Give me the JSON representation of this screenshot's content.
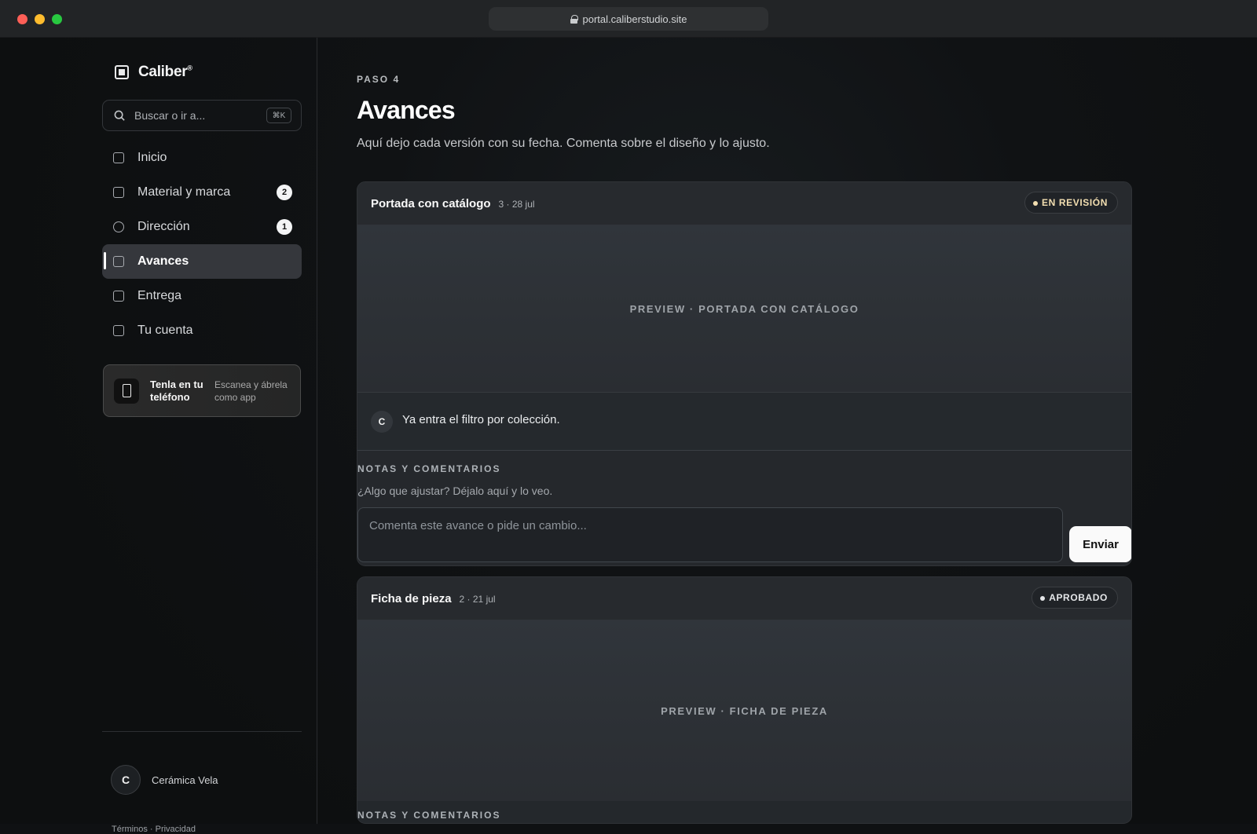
{
  "browser": {
    "url": "portal.caliberstudio.site"
  },
  "brand": {
    "name": "Caliber",
    "trademark": "®"
  },
  "search": {
    "placeholder": "Buscar o ir a...",
    "shortcut": "⌘K"
  },
  "navigation": [
    {
      "label": "Inicio",
      "icon": "home-icon"
    },
    {
      "label": "Material y marca",
      "icon": "image-icon",
      "badge": "2"
    },
    {
      "label": "Dirección",
      "icon": "target-icon",
      "badge": "1"
    },
    {
      "label": "Avances",
      "icon": "chart-icon",
      "active": true
    },
    {
      "label": "Entrega",
      "icon": "package-icon"
    },
    {
      "label": "Tu cuenta",
      "icon": "card-icon"
    }
  ],
  "phone_promo": {
    "title": "Tenla en tu teléfono",
    "subtitle": "Escanea y ábrela como app"
  },
  "user": {
    "initial": "C",
    "name": "Cerámica Vela"
  },
  "legal": "Términos · Privacidad",
  "page": {
    "step": "PASO 4",
    "title": "Avances",
    "subtitle": "Aquí dejo cada versión con su fecha. Comenta sobre el diseño y lo ajusto."
  },
  "cards": [
    {
      "title": "Portada con catálogo",
      "meta": "3 · 28 jul",
      "status": "EN REVISIÓN",
      "status_color": "#f3dfb1",
      "preview": "PREVIEW · PORTADA CON CATÁLOGO",
      "comment_initial": "C",
      "comment": "Ya entra el filtro por colección.",
      "notes_title": "NOTAS Y COMENTARIOS",
      "notes_help": "¿Algo que ajustar? Déjalo aquí y lo veo.",
      "input_placeholder": "Comenta este avance o pide un cambio...",
      "send_label": "Enviar"
    },
    {
      "title": "Ficha de pieza",
      "meta": "2 · 21 jul",
      "status": "APROBADO",
      "status_color": "#e4e6e8",
      "preview": "PREVIEW · FICHA DE PIEZA",
      "notes_title": "NOTAS Y COMENTARIOS"
    }
  ]
}
